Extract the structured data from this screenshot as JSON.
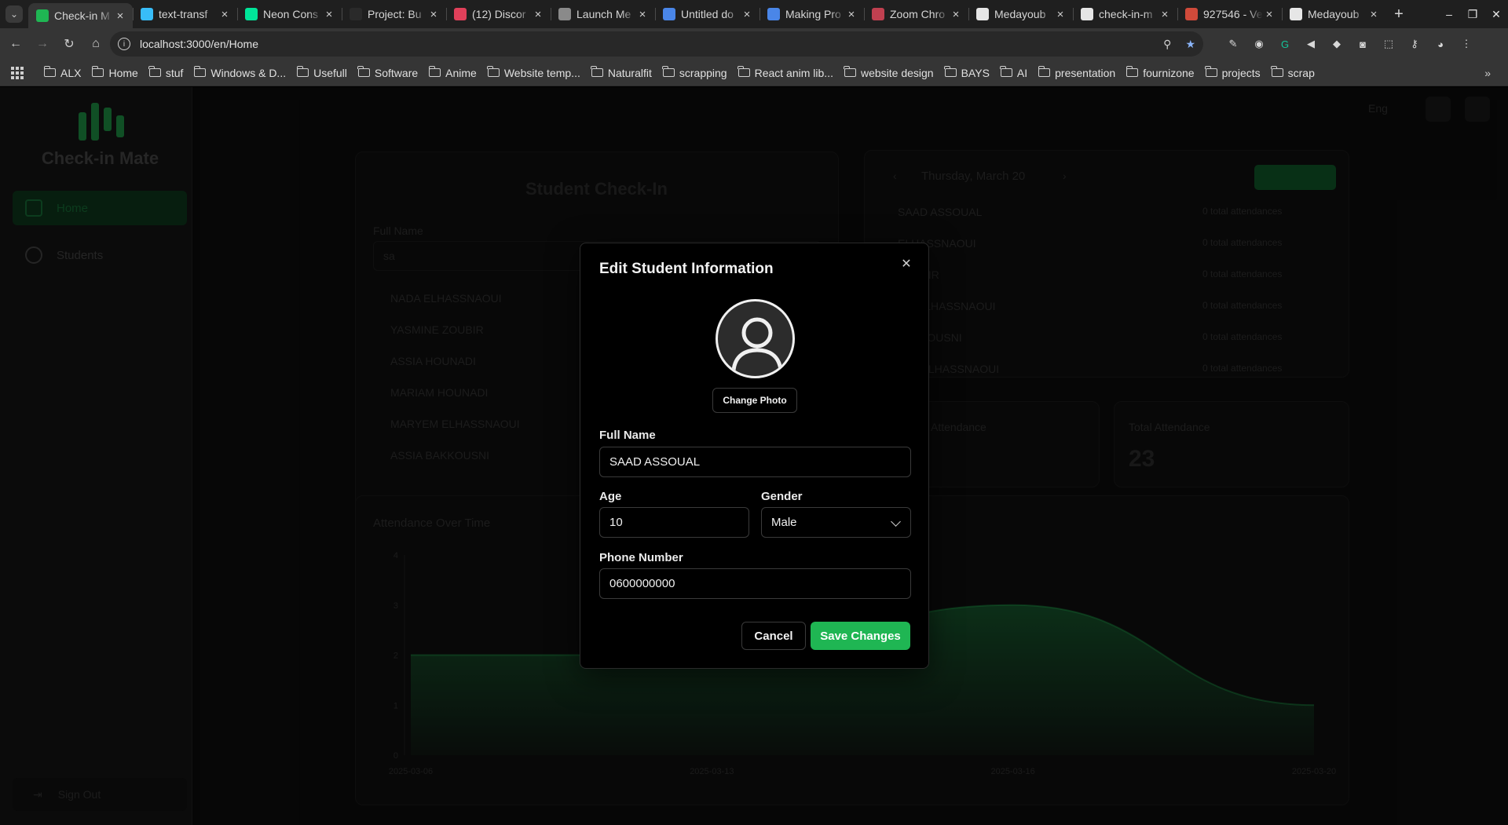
{
  "browser": {
    "tabs": [
      {
        "title": "Check-in M",
        "favicon_color": "#1fb653",
        "active": true
      },
      {
        "title": "text-transf",
        "favicon_color": "#38bdf8",
        "active": false
      },
      {
        "title": "Neon Cons",
        "favicon_color": "#00e599",
        "active": false
      },
      {
        "title": "Project: Bu",
        "favicon_color": "#2a2a2a",
        "active": false
      },
      {
        "title": "(12) Discor",
        "favicon_color": "#e0405a",
        "active": false
      },
      {
        "title": "Launch Me",
        "favicon_color": "#8a8a8a",
        "active": false
      },
      {
        "title": "Untitled do",
        "favicon_color": "#4a86e8",
        "active": false
      },
      {
        "title": "Making Pro",
        "favicon_color": "#4a86e8",
        "active": false
      },
      {
        "title": "Zoom Chro",
        "favicon_color": "#c04050",
        "active": false
      },
      {
        "title": "Medayoub",
        "favicon_color": "#e6e6e6",
        "active": false
      },
      {
        "title": "check-in-m",
        "favicon_color": "#e6e6e6",
        "active": false
      },
      {
        "title": "927546 - Ve",
        "favicon_color": "#d04a3a",
        "active": false
      },
      {
        "title": "Medayoub",
        "favicon_color": "#e6e6e6",
        "active": false
      }
    ],
    "url": "localhost:3000/en/Home",
    "bookmarks": [
      "ALX",
      "Home",
      "stuf",
      "Windows & D...",
      "Usefull",
      "Software",
      "Anime",
      "Website temp...",
      "Naturalfit",
      "scrapping",
      "React anim lib...",
      "website design",
      "BAYS",
      "AI",
      "presentation",
      "fournizone",
      "projects",
      "scrap"
    ]
  },
  "app": {
    "name": "Check-in Mate",
    "nav": [
      "Home",
      "Students"
    ],
    "sign_out": "Sign Out",
    "checkin_title": "Student Check-In",
    "full_name_label": "Full Name",
    "search_value": "sa",
    "suggestions": [
      "NADA ELHASSNAOUI",
      "YASMINE ZOUBIR",
      "ASSIA HOUNADI",
      "MARIAM HOUNADI",
      "MARYEM ELHASSNAOUI",
      "ASSIA BAKKOUSNI"
    ],
    "date_label": "Thursday, March 20",
    "checkin_rows": [
      "SAAD ASSOUAL",
      "ELHASSNAOUI",
      "ZOUBIR",
      "EM ELHASSNAOUI",
      "BAKKOUSNI",
      "MIN ELHASSNAOUI"
    ],
    "attendance_note": "0 total attendances",
    "today_attendance_label": "Attendance",
    "total_attendance_label": "Total Attendance",
    "total_attendance_value": "23",
    "chart_title": "Attendance Over Time",
    "lang": "Eng"
  },
  "chart_data": {
    "type": "area",
    "title": "Attendance Over Time",
    "x": [
      "2025-03-06",
      "2025-03-13",
      "2025-03-16",
      "2025-03-20"
    ],
    "values": [
      2,
      2,
      3,
      1
    ],
    "yticks": [
      "0",
      "1",
      "2",
      "3",
      "4"
    ],
    "ylim": [
      0,
      4
    ],
    "color": "#1fb653"
  },
  "modal": {
    "title": "Edit Student Information",
    "change_photo": "Change Photo",
    "full_name_label": "Full Name",
    "full_name_value": "SAAD ASSOUAL",
    "age_label": "Age",
    "age_value": "10",
    "gender_label": "Gender",
    "gender_value": "Male",
    "phone_label": "Phone Number",
    "phone_value": "0600000000",
    "cancel": "Cancel",
    "save": "Save Changes"
  },
  "colors": {
    "accent": "#1fb653",
    "modal_bg": "#000000",
    "border": "#3a3a3a"
  }
}
